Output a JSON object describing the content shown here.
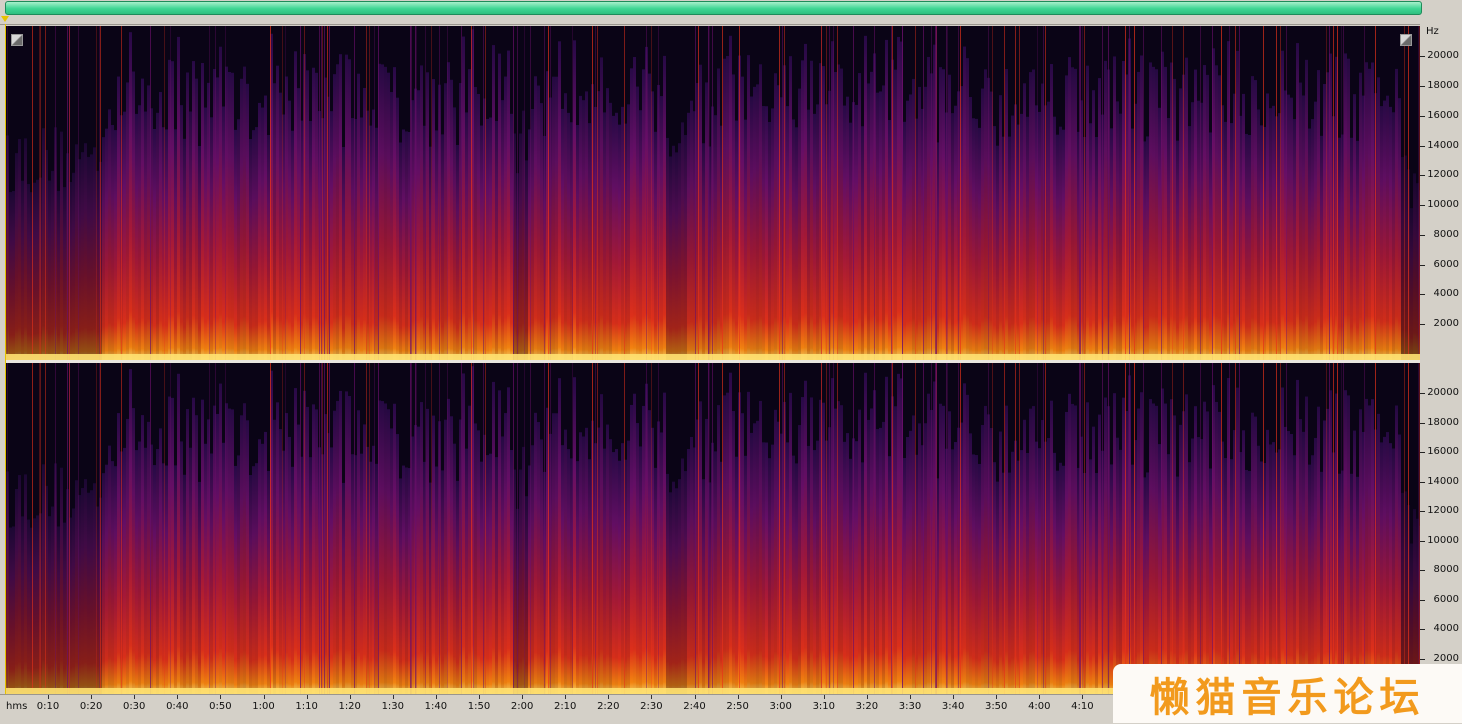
{
  "overview_bar": {
    "color": "#3fd694"
  },
  "spectrogram": {
    "channels": 2,
    "colormap": [
      "#0a0416",
      "#2a0a4a",
      "#6a0f6a",
      "#b01a3a",
      "#e8321a",
      "#ff8a10",
      "#ffe070"
    ]
  },
  "freq_axis": {
    "unit": "Hz",
    "labels": [
      "20000",
      "18000",
      "16000",
      "14000",
      "12000",
      "10000",
      "8000",
      "6000",
      "4000",
      "2000"
    ]
  },
  "time_axis": {
    "unit_label": "hms",
    "labels": [
      "0:10",
      "0:20",
      "0:30",
      "0:40",
      "0:50",
      "1:00",
      "1:10",
      "1:20",
      "1:30",
      "1:40",
      "1:50",
      "2:00",
      "2:10",
      "2:20",
      "2:30",
      "2:40",
      "2:50",
      "3:00",
      "3:10",
      "3:20",
      "3:30",
      "3:40",
      "3:50",
      "4:00",
      "4:10"
    ]
  },
  "watermark": {
    "text": "懒猫音乐论坛",
    "color": "#f29a1d"
  }
}
